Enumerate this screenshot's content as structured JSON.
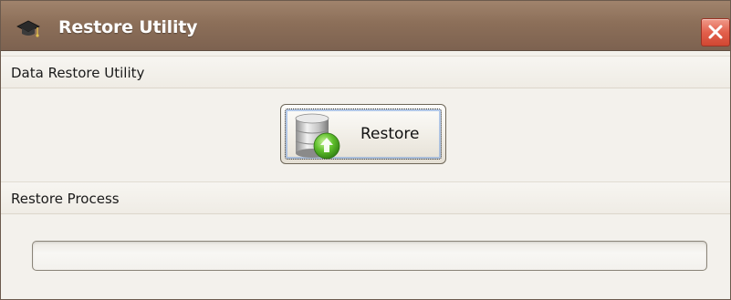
{
  "window": {
    "title": "Restore Utility",
    "title_icon": "graduation-cap-icon",
    "close_icon": "close-icon",
    "close_color": "#e05a45"
  },
  "sections": {
    "utility_header": "Data Restore Utility",
    "process_header": "Restore  Process"
  },
  "restore_button": {
    "label": "Restore",
    "icon": "database-upload-icon"
  },
  "progress": {
    "value": 0
  }
}
